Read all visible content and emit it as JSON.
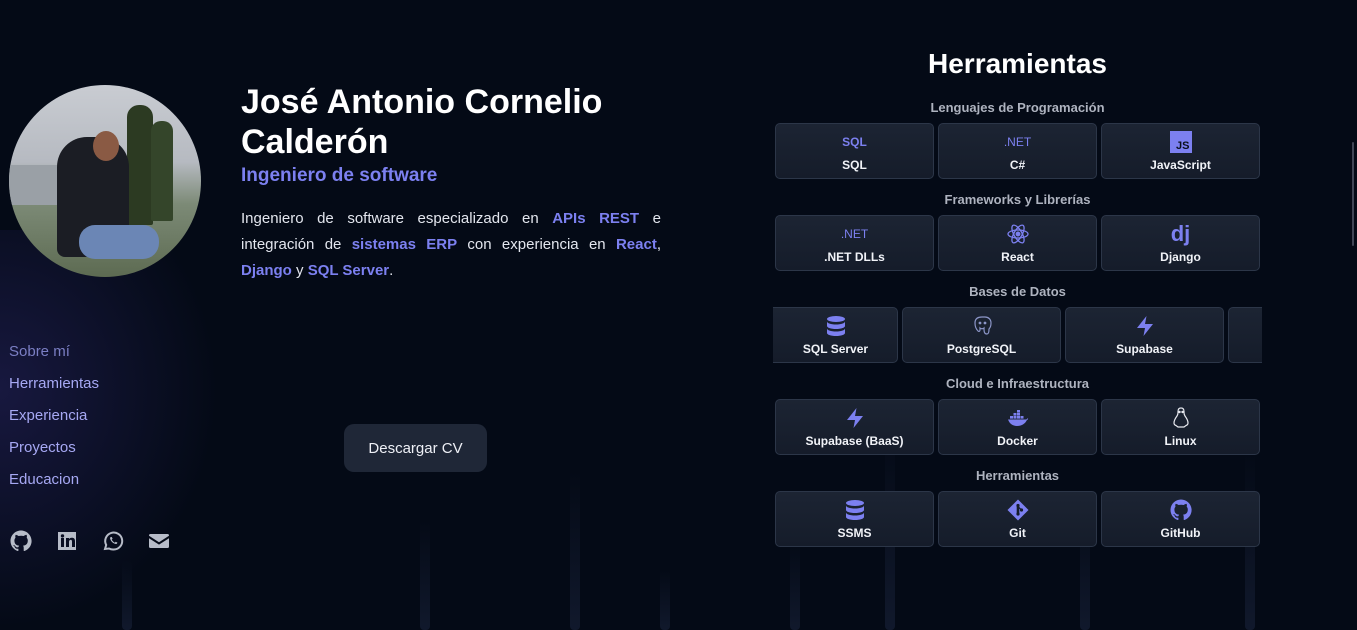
{
  "profile": {
    "name": "José Antonio Cornelio Calderón",
    "role": "Ingeniero de software",
    "bio": {
      "t1": "Ingeniero de software especializado en ",
      "h1": "APIs REST",
      "t2": " e integración de ",
      "h2": "sistemas ERP",
      "t3": " con experiencia en ",
      "h3": "React",
      "t4": ", ",
      "h4": "Django",
      "t5": " y ",
      "h5": "SQL Server",
      "t6": "."
    },
    "cv_button": "Descargar CV"
  },
  "nav": {
    "items": [
      "Sobre mí",
      "Herramientas",
      "Experiencia",
      "Proyectos",
      "Educacion"
    ]
  },
  "socials": [
    "github-icon",
    "linkedin-icon",
    "whatsapp-icon",
    "mail-icon"
  ],
  "tools": {
    "title": "Herramientas",
    "categories": [
      {
        "title": "Lenguajes de Programación",
        "items": [
          {
            "label": "SQL",
            "icon_text": "SQL",
            "icon": "sql-icon"
          },
          {
            "label": "C#",
            "icon_text": ".NET",
            "icon": "dotnet-icon"
          },
          {
            "label": "JavaScript",
            "icon_text": "JS",
            "icon": "javascript-icon"
          }
        ]
      },
      {
        "title": "Frameworks y Librerías",
        "items": [
          {
            "label": ".NET DLLs",
            "icon_text": ".NET",
            "icon": "dotnet-icon"
          },
          {
            "label": "React",
            "icon": "react-icon"
          },
          {
            "label": "Django",
            "icon_text": "dj",
            "icon": "django-icon"
          }
        ]
      },
      {
        "title": "Bases de Datos",
        "items": [
          {
            "label": "SQL Server",
            "icon": "database-icon"
          },
          {
            "label": "PostgreSQL",
            "icon": "postgresql-icon"
          },
          {
            "label": "Supabase",
            "icon": "supabase-icon"
          }
        ]
      },
      {
        "title": "Cloud e Infraestructura",
        "items": [
          {
            "label": "Supabase (BaaS)",
            "icon": "supabase-icon"
          },
          {
            "label": "Docker",
            "icon": "docker-icon"
          },
          {
            "label": "Linux",
            "icon": "linux-icon"
          }
        ]
      },
      {
        "title": "Herramientas",
        "items": [
          {
            "label": "SSMS",
            "icon": "database-icon"
          },
          {
            "label": "Git",
            "icon": "git-icon"
          },
          {
            "label": "GitHub",
            "icon": "github-icon"
          }
        ]
      }
    ]
  },
  "colors": {
    "background": "#040a16",
    "accent": "#7c80f0",
    "card": "#1a2231",
    "nav_text": "#a6a8f3"
  }
}
